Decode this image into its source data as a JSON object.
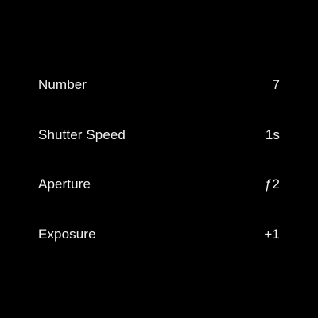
{
  "settings": {
    "items": [
      {
        "label": "Number",
        "value": "7"
      },
      {
        "label": "Shutter Speed",
        "value": "1s"
      },
      {
        "label": "Aperture",
        "value": "ƒ2"
      },
      {
        "label": "Exposure",
        "value": "+1"
      }
    ]
  },
  "colors": {
    "background": "#000000",
    "text": "#f2f2f2"
  }
}
